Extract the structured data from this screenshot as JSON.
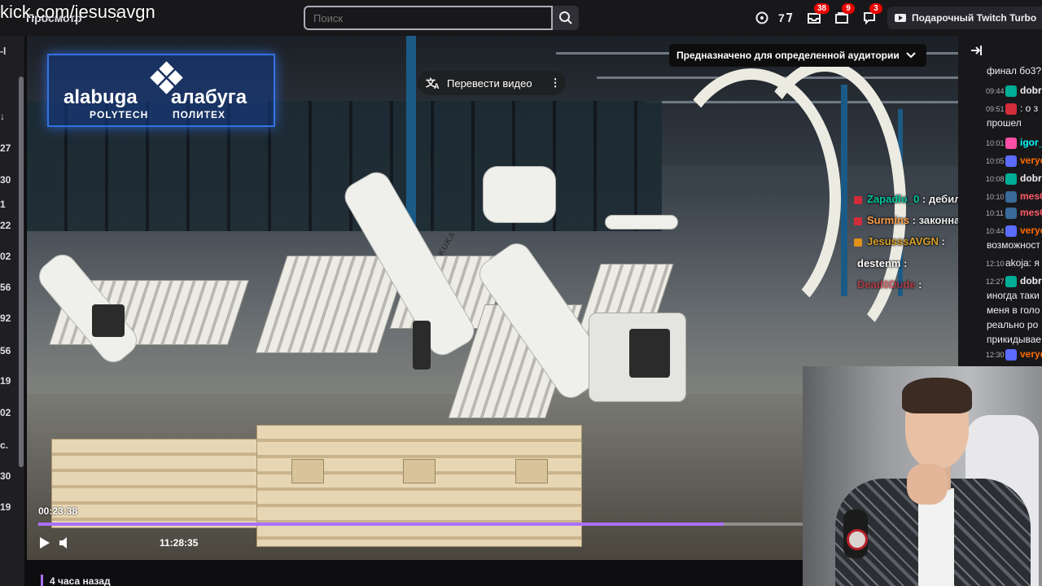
{
  "watermark": "kick.com/jesusavgn",
  "nav": {
    "browse_label": "Просмотр",
    "more_label": "⋮"
  },
  "search": {
    "placeholder": "Поиск"
  },
  "top_icons": [
    {
      "name": "crown-icon",
      "badge": ""
    },
    {
      "name": "prime-icon",
      "badge": ""
    },
    {
      "name": "inbox-icon",
      "badge": "38"
    },
    {
      "name": "gift-icon",
      "badge": "9"
    },
    {
      "name": "notifications-icon",
      "badge": "3"
    }
  ],
  "turbo": {
    "label": "Подарочный Twitch Turbo"
  },
  "left_sidebar": {
    "numbers": [
      "-l",
      "↓",
      "27",
      "30",
      "1",
      "22",
      "02",
      "56",
      "92",
      "56",
      "19",
      "02",
      "с.",
      "30",
      "19"
    ]
  },
  "video": {
    "logo": {
      "latin_name": "alabuga",
      "latin_sub": "POLYTECH",
      "cyrillic_name": "алабуга",
      "cyrillic_sub": "ПОЛИТЕХ"
    },
    "robot_brand": "KUKA",
    "translate_label": "Перевести видео",
    "audience_label": "Предназначено для определенной аудитории",
    "current_time": "00:23:38",
    "total_time": "11:28:35",
    "progress_fraction": 0.745,
    "overlay_chat": [
      {
        "name": "Zapadlo_0",
        "text": " : дебилы",
        "name_color": "#00c8a0",
        "badge_color": "#d02c3a"
      },
      {
        "name": "Surmins",
        "text": " : законная цель",
        "name_color": "#ff9e4a",
        "badge_color": "#d02c3a"
      },
      {
        "name": "JesusssAVGN",
        "text": " :",
        "name_color": "#d6a02a",
        "badge_color": "#e1901b"
      },
      {
        "name": "destenm",
        "text": " :",
        "name_color": "#ffffff",
        "badge_color": ""
      },
      {
        "name": "Dead0Dude",
        "text": " :",
        "name_color": "#d02c3a",
        "badge_color": ""
      }
    ]
  },
  "chat": {
    "messages": [
      {
        "time": "",
        "name": "",
        "text": "финал бо3?",
        "name_color": "#efeff1",
        "badge_color": ""
      },
      {
        "time": "09:44",
        "name": "dobr",
        "text": "",
        "name_color": "#efeff1",
        "badge_color": "#00ad96"
      },
      {
        "time": "09:51",
        "name": "",
        "text": ": о з",
        "name_color": "#5c6bff",
        "badge_color": "#d02c3a"
      },
      {
        "time": "",
        "name": "",
        "text": "прошел",
        "name_color": "#efeff1",
        "badge_color": ""
      },
      {
        "time": "10:01",
        "name": "igor_",
        "text": "",
        "name_color": "#00ffff",
        "badge_color": "#ff4fa8"
      },
      {
        "time": "10:05",
        "name": "verydru",
        "text": "",
        "name_color": "#ff6a00",
        "badge_color": "#5c6bff"
      },
      {
        "time": "10:08",
        "name": "dobr",
        "text": "",
        "name_color": "#efeff1",
        "badge_color": "#00ad96"
      },
      {
        "time": "10:10",
        "name": "mesOri:",
        "text": "",
        "name_color": "#ff5a6a",
        "badge_color": "#3a6a9a"
      },
      {
        "time": "10:11",
        "name": "mesOri:",
        "text": "",
        "name_color": "#ff5a6a",
        "badge_color": "#3a6a9a"
      },
      {
        "time": "10:44",
        "name": "verydru",
        "text": "",
        "name_color": "#ff6a00",
        "badge_color": "#5c6bff"
      },
      {
        "time": "",
        "name": "",
        "text": "возможност",
        "name_color": "#efeff1",
        "badge_color": ""
      },
      {
        "time": "12:10",
        "name": "",
        "text": "akoja: я по",
        "name_color": "#efeff1",
        "badge_color": ""
      },
      {
        "time": "12:27",
        "name": "dobr",
        "text": "",
        "name_color": "#efeff1",
        "badge_color": "#00ad96"
      },
      {
        "time": "",
        "name": "",
        "text": "иногда таки",
        "name_color": "#efeff1",
        "badge_color": ""
      },
      {
        "time": "",
        "name": "",
        "text": "меня в голо",
        "name_color": "#efeff1",
        "badge_color": ""
      },
      {
        "time": "",
        "name": "",
        "text": "реально ро",
        "name_color": "#efeff1",
        "badge_color": ""
      },
      {
        "time": "",
        "name": "",
        "text": "прикидывае",
        "name_color": "#efeff1",
        "badge_color": ""
      },
      {
        "time": "12:30",
        "name": "verydru",
        "text": "",
        "name_color": "#ff6a00",
        "badge_color": "#5c6bff"
      }
    ]
  },
  "below_video": {
    "timestamp": "4 часа назад"
  }
}
